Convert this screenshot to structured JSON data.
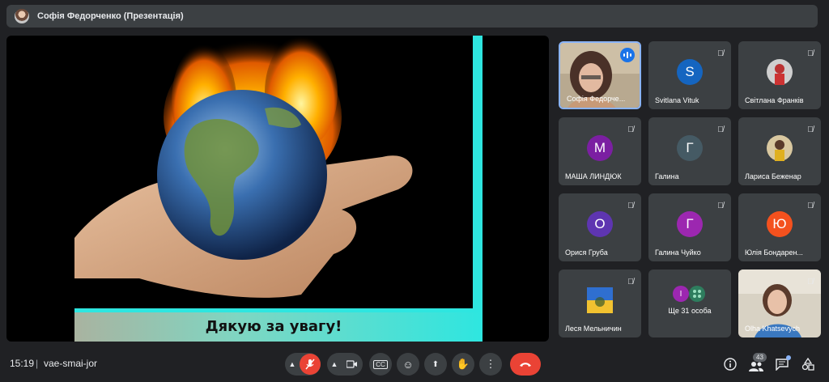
{
  "header": {
    "presenter_title": "Софія Федорченко (Презентація)"
  },
  "slide": {
    "caption": "Дякую за увагу!"
  },
  "participants": [
    {
      "name": "Софія Федорче...",
      "type": "video",
      "speaking": true
    },
    {
      "name": "Svitlana Vituk",
      "type": "initial",
      "initial": "S",
      "color": "#1565c0",
      "muted": true
    },
    {
      "name": "Світлана Франків",
      "type": "photo",
      "muted": true
    },
    {
      "name": "МАША ЛИНДЮК",
      "type": "initial",
      "initial": "М",
      "color": "#7b1fa2",
      "muted": true
    },
    {
      "name": "Галина",
      "type": "initial",
      "initial": "Г",
      "color": "#455a64",
      "muted": true
    },
    {
      "name": "Лариса Беженар",
      "type": "photo",
      "muted": true
    },
    {
      "name": "Орися Груба",
      "type": "initial",
      "initial": "О",
      "color": "#5e35b1",
      "muted": true
    },
    {
      "name": "Галина Чуйко",
      "type": "initial",
      "initial": "Г",
      "color": "#9c27b0",
      "muted": true
    },
    {
      "name": "Юлія Бондарен...",
      "type": "initial",
      "initial": "Ю",
      "color": "#f4511e",
      "muted": true
    },
    {
      "name": "Леся Мельничин",
      "type": "photo",
      "muted": true
    },
    {
      "name": "Ще 31 особа",
      "type": "more",
      "muted": false
    },
    {
      "name": "Olha Khatsevych",
      "type": "video",
      "muted": true
    }
  ],
  "more_tile": {
    "initial": "І"
  },
  "bottom": {
    "time": "15:19",
    "separator": "|",
    "meeting_code": "vae-smai-jor",
    "people_count": "43"
  },
  "controls": {
    "mic_state": "off",
    "icons": [
      "chevron-up-icon",
      "mic-off-icon",
      "chevron-up-icon",
      "camera-icon",
      "captions-icon",
      "emoji-icon",
      "present-icon",
      "raise-hand-icon",
      "more-options-icon",
      "end-call-icon"
    ]
  },
  "right_icons": [
    "info-icon",
    "people-icon",
    "chat-icon",
    "activities-icon"
  ],
  "colors": {
    "background": "#202124",
    "tile": "#3c4043",
    "danger": "#ea4335",
    "accent": "#8ab4f8",
    "slide_accent": "#2ee6e0"
  }
}
